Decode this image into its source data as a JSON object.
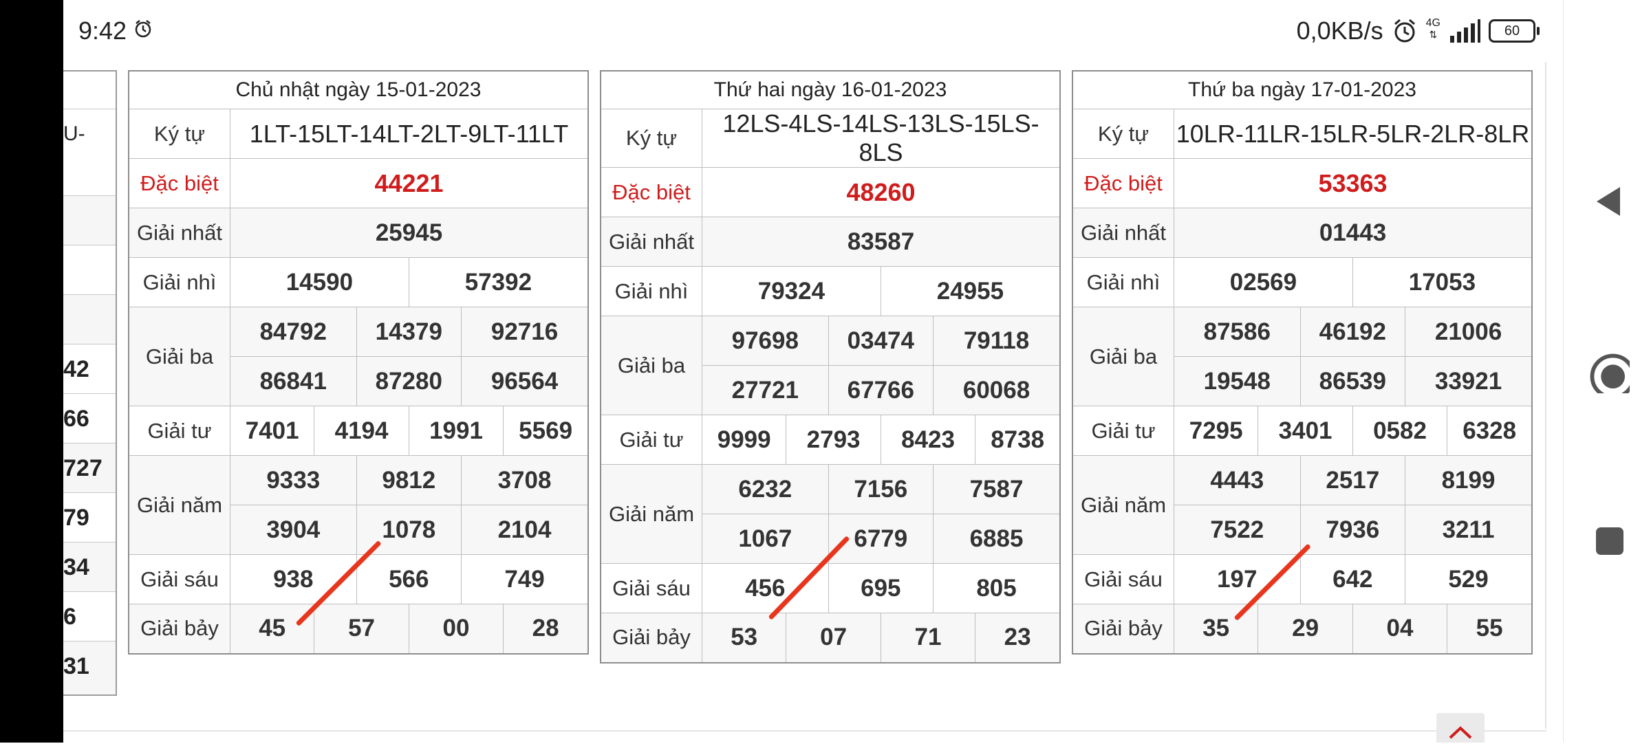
{
  "status": {
    "time": "9:42",
    "net_speed": "0,0KB/s",
    "network": "4G",
    "battery": "60"
  },
  "partial_table": {
    "texts": [
      "U-",
      "",
      "",
      "",
      "42",
      "66",
      "727",
      "79",
      "34",
      "6",
      "31"
    ]
  },
  "labels": {
    "code": "Ký tự",
    "special": "Đặc biệt",
    "first": "Giải nhất",
    "second": "Giải nhì",
    "third": "Giải ba",
    "fourth": "Giải tư",
    "fifth": "Giải năm",
    "sixth": "Giải sáu",
    "seventh": "Giải bảy"
  },
  "days": [
    {
      "title": "Chủ nhật ngày 15-01-2023",
      "code": "1LT-15LT-14LT-2LT-9LT-11LT",
      "special": "44221",
      "first": "25945",
      "second": [
        "14590",
        "57392"
      ],
      "third": [
        "84792",
        "14379",
        "92716",
        "86841",
        "87280",
        "96564"
      ],
      "fourth": [
        "7401",
        "4194",
        "1991",
        "5569"
      ],
      "fifth": [
        "9333",
        "9812",
        "3708",
        "3904",
        "1078",
        "2104"
      ],
      "sixth": [
        "938",
        "566",
        "749"
      ],
      "seventh": [
        "45",
        "57",
        "00",
        "28"
      ]
    },
    {
      "title": "Thứ hai ngày 16-01-2023",
      "code": "12LS-4LS-14LS-13LS-15LS-8LS",
      "special": "48260",
      "first": "83587",
      "second": [
        "79324",
        "24955"
      ],
      "third": [
        "97698",
        "03474",
        "79118",
        "27721",
        "67766",
        "60068"
      ],
      "fourth": [
        "9999",
        "2793",
        "8423",
        "8738"
      ],
      "fifth": [
        "6232",
        "7156",
        "7587",
        "1067",
        "6779",
        "6885"
      ],
      "sixth": [
        "456",
        "695",
        "805"
      ],
      "seventh": [
        "53",
        "07",
        "71",
        "23"
      ]
    },
    {
      "title": "Thứ ba ngày 17-01-2023",
      "code": "10LR-11LR-15LR-5LR-2LR-8LR",
      "special": "53363",
      "first": "01443",
      "second": [
        "02569",
        "17053"
      ],
      "third": [
        "87586",
        "46192",
        "21006",
        "19548",
        "86539",
        "33921"
      ],
      "fourth": [
        "7295",
        "3401",
        "0582",
        "6328"
      ],
      "fifth": [
        "4443",
        "2517",
        "8199",
        "7522",
        "7936",
        "3211"
      ],
      "sixth": [
        "197",
        "642",
        "529"
      ],
      "seventh": [
        "35",
        "29",
        "04",
        "55"
      ]
    }
  ]
}
